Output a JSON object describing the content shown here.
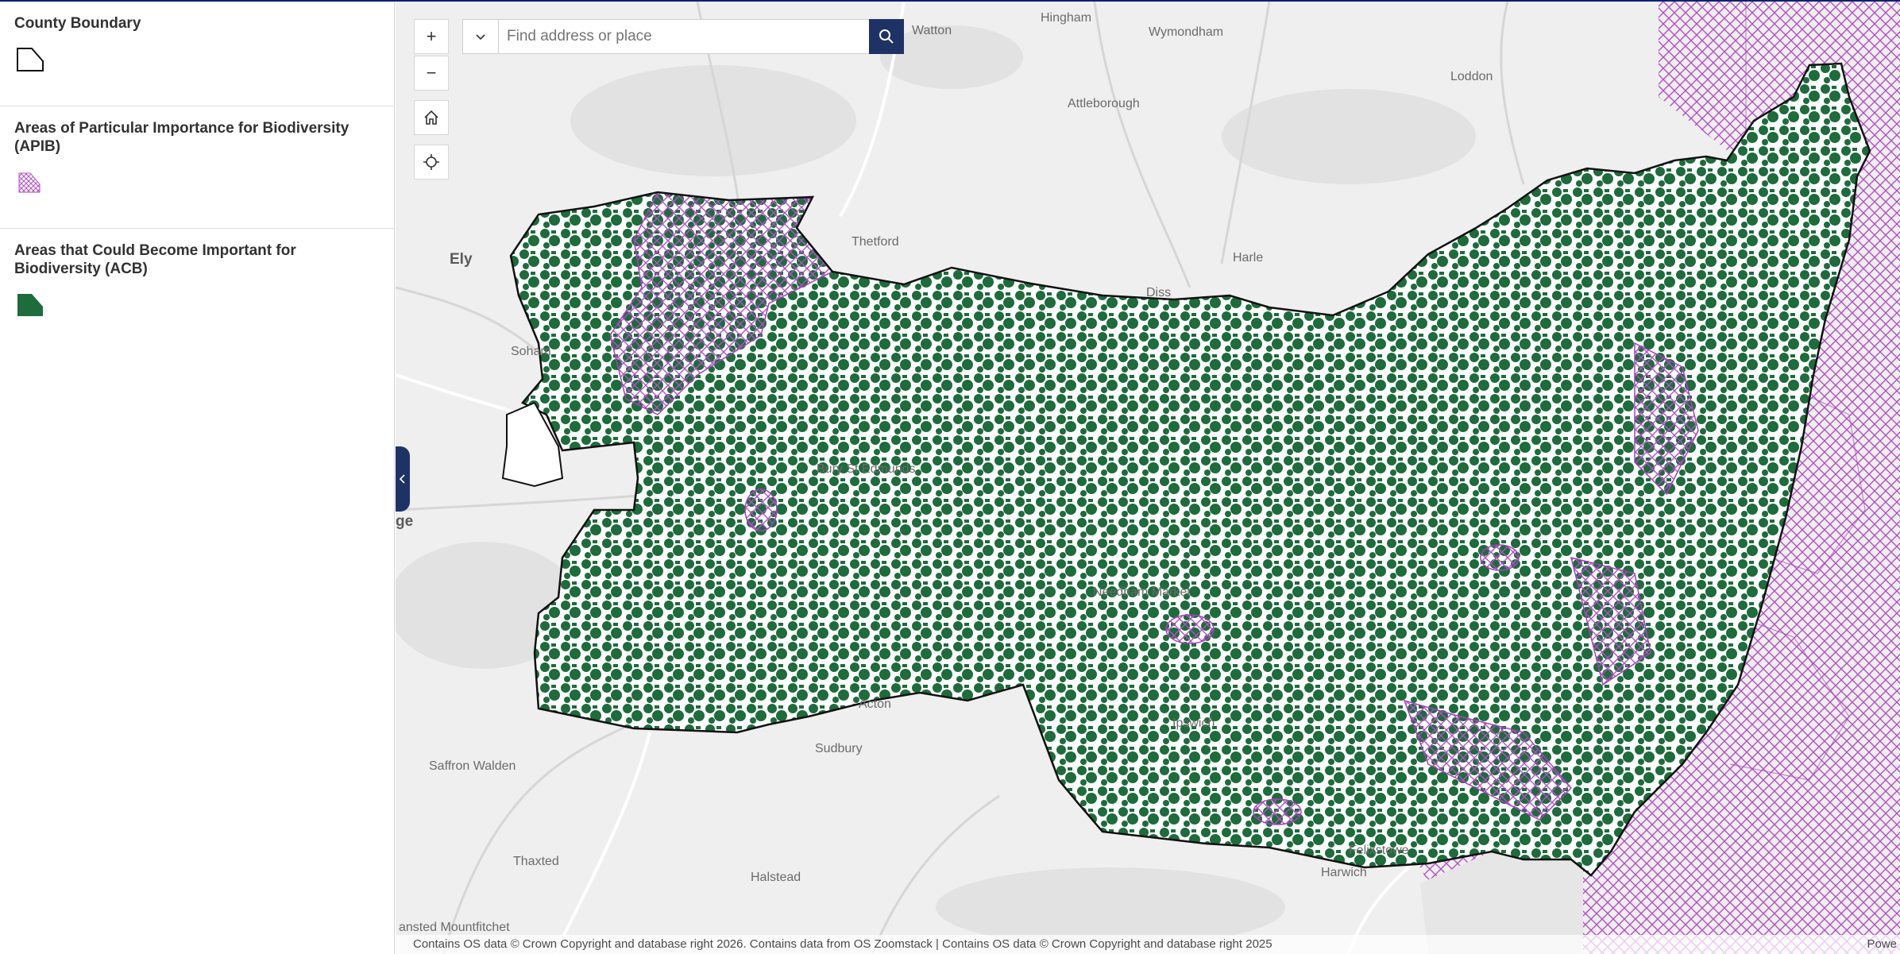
{
  "legend": {
    "items": [
      {
        "title": "County Boundary",
        "symbol": "outline-polygon-icon"
      },
      {
        "title": "Areas of Particular Importance for Biodiversity (APIB)",
        "symbol": "purple-hatch-icon"
      },
      {
        "title": "Areas that Could Become Important for Biodiversity (ACB)",
        "symbol": "green-fill-icon"
      }
    ]
  },
  "search": {
    "placeholder": "Find address or place"
  },
  "controls": {
    "zoom_in": "+",
    "zoom_out": "−"
  },
  "places": [
    "Watton",
    "Hingham",
    "Wymondham",
    "Loddon",
    "Attleborough",
    "Thetford",
    "Ely",
    "Harle",
    "Diss",
    "Soham",
    "Saffron Walden",
    "Thaxted",
    "Halstead",
    "ansted Mountfitchet",
    "ge",
    "Acton",
    "Sudbury",
    "Ipswich",
    "Needham Market",
    "Bury St Edmunds",
    "Felixstowe",
    "Harwich"
  ],
  "attribution": "Contains OS data © Crown Copyright and database right 2026. Contains data from OS Zoomstack | Contains OS data © Crown Copyright and database right 2025",
  "powered": "Powe",
  "colors": {
    "apib": "#b44fc8",
    "acb": "#1e6b3c",
    "boundary": "#111111",
    "accent": "#1f3266"
  }
}
